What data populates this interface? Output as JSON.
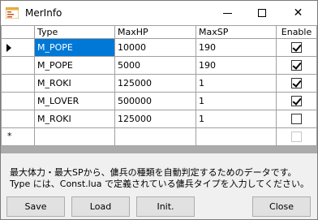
{
  "window": {
    "title": "MerInfo",
    "minimize_glyph": "",
    "maximize_glyph": "",
    "close_glyph": "✕"
  },
  "grid": {
    "columns": [
      "Type",
      "MaxHP",
      "MaxSP",
      "Enable"
    ],
    "rows": [
      {
        "type": "M_POPE",
        "maxhp": "10000",
        "maxsp": "190",
        "enable": true
      },
      {
        "type": "M_POPE",
        "maxhp": "5000",
        "maxsp": "190",
        "enable": true
      },
      {
        "type": "M_ROKI",
        "maxhp": "125000",
        "maxsp": "1",
        "enable": true
      },
      {
        "type": "M_LOVER",
        "maxhp": "500000",
        "maxsp": "1",
        "enable": true
      },
      {
        "type": "M_ROKI",
        "maxhp": "125000",
        "maxsp": "1",
        "enable": false
      }
    ],
    "new_row_marker": "*"
  },
  "description": {
    "line1": "最大体力・最大SPから、傭兵の種類を自動判定するためのデータです。",
    "line2": "Type には、Const.lua で定義されている傭兵タイプを入力してください。"
  },
  "buttons": {
    "save": "Save",
    "load": "Load",
    "init": "Init.",
    "close": "Close"
  },
  "colors": {
    "selection": "#0078d7",
    "grid_background": "#ababab"
  }
}
